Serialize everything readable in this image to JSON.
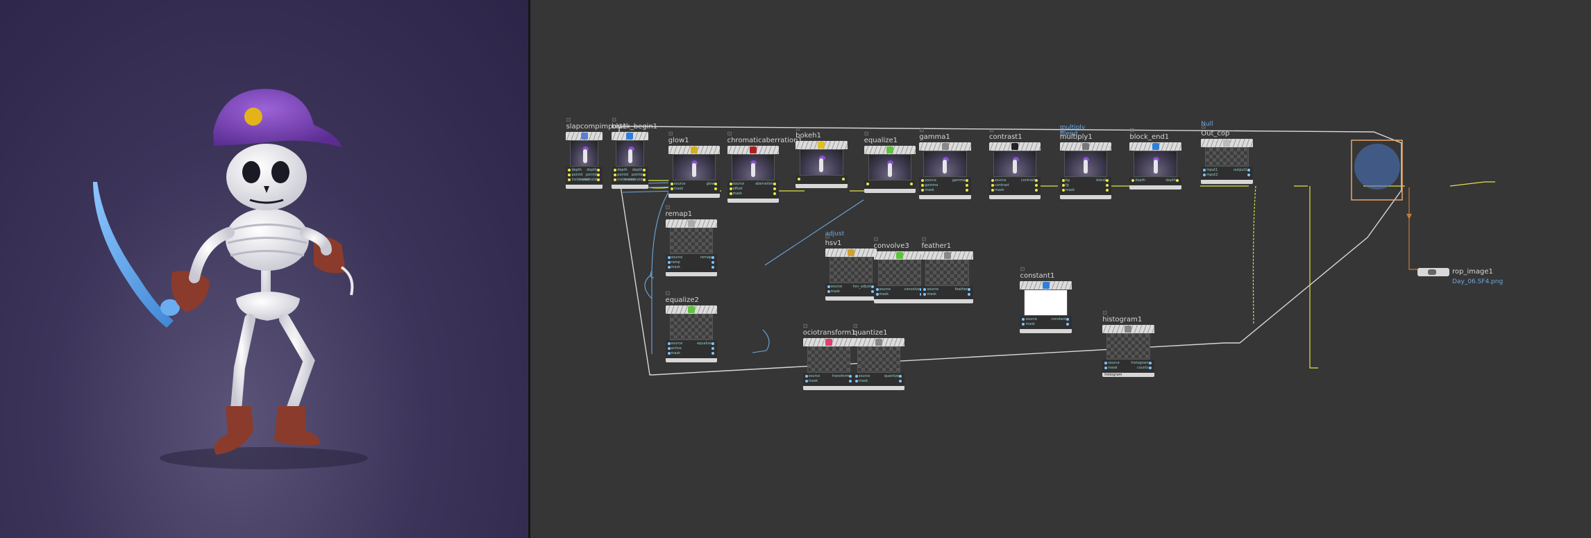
{
  "network": {
    "block_begin_label": "block_begin1",
    "nodes": [
      {
        "id": "slapcompimport1",
        "title": "slapcompimport1",
        "thumb": "skel",
        "ports": [
          [
            "depth",
            "depth"
          ],
          [
            "pointd",
            "pointd"
          ],
          [
            "instanceid",
            "instanceid"
          ]
        ],
        "icon": "#5a7fd0"
      },
      {
        "id": "block_begin1",
        "title": "block_begin1",
        "thumb": "skel",
        "ports": [
          [
            "depth",
            "depth"
          ],
          [
            "pointd",
            "pointd"
          ],
          [
            "instanceid",
            "instanceid"
          ]
        ],
        "icon": "#2f7fd8"
      },
      {
        "id": "glow1",
        "title": "glow1",
        "thumb": "skel",
        "ports": [
          [
            "source",
            "glow"
          ],
          [
            "mask",
            ""
          ]
        ],
        "icon": "#d0b020"
      },
      {
        "id": "chromaticaberration1",
        "title": "chromaticaberration1",
        "thumb": "skel",
        "ports": [
          [
            "source",
            "aberration"
          ],
          [
            "offset",
            ""
          ],
          [
            "mask",
            ""
          ]
        ],
        "icon": "#b02020"
      },
      {
        "id": "bokeh1",
        "title": "bokeh1",
        "thumb": "skel",
        "ports": [
          [
            "",
            ""
          ]
        ],
        "icon": "#e0c020"
      },
      {
        "id": "equalize1",
        "title": "equalize1",
        "thumb": "skel",
        "ports": [
          [
            "",
            ""
          ]
        ],
        "icon": "#60c040"
      },
      {
        "id": "gamma1",
        "title": "gamma1",
        "thumb": "skel",
        "ports": [
          [
            "source",
            "gamma"
          ],
          [
            "gamma",
            ""
          ],
          [
            "mask",
            ""
          ]
        ],
        "icon": "#888"
      },
      {
        "id": "contrast1",
        "title": "contrast1",
        "thumb": "skel",
        "ports": [
          [
            "source",
            "contrast"
          ],
          [
            "contrast",
            ""
          ],
          [
            "mask",
            ""
          ]
        ],
        "icon": "#222"
      },
      {
        "id": "multiply1",
        "title": "multiply1",
        "sup": "multiply\nBlend",
        "thumb": "skel",
        "ports": [
          [
            "bg",
            "blend"
          ],
          [
            "fg",
            ""
          ],
          [
            "mask",
            ""
          ]
        ],
        "icon": "#777"
      },
      {
        "id": "block_end1",
        "title": "block_end1",
        "thumb": "skel",
        "ports": [
          [
            "depth",
            "depth"
          ]
        ],
        "icon": "#2f7fd8"
      },
      {
        "id": "Out_cop",
        "title": "Out_cop",
        "sup": "Null",
        "thumb": "checker",
        "ports": [
          [
            "input1",
            "output1"
          ],
          [
            "input2",
            ""
          ]
        ],
        "icon": "#bbb"
      },
      {
        "id": "remap1",
        "title": "remap1",
        "thumb": "checker",
        "ports": [
          [
            "source",
            "remap"
          ],
          [
            "ramp",
            ""
          ],
          [
            "mask",
            ""
          ]
        ],
        "icon": "#aaa"
      },
      {
        "id": "equalize2",
        "title": "equalize2",
        "thumb": "checker",
        "ports": [
          [
            "source",
            "equalize"
          ],
          [
            "active",
            ""
          ],
          [
            "mask",
            ""
          ]
        ],
        "icon": "#60c040"
      },
      {
        "id": "hsv1",
        "title": "hsv1",
        "sup": "adjust",
        "thumb": "checker",
        "ports": [
          [
            "source",
            "hsv_adjust"
          ],
          [
            "mask",
            ""
          ]
        ],
        "icon": "#d0a030"
      },
      {
        "id": "convolve3",
        "title": "convolve3",
        "thumb": "checker",
        "ports": [
          [
            "source",
            "convolve"
          ],
          [
            "mask",
            ""
          ]
        ],
        "icon": "#60c040"
      },
      {
        "id": "feather1",
        "title": "feather1",
        "thumb": "checker",
        "ports": [
          [
            "source",
            "feather"
          ],
          [
            "mask",
            ""
          ]
        ],
        "icon": "#888"
      },
      {
        "id": "ociotransform1",
        "title": "ociotransform1",
        "thumb": "checker",
        "ports": [
          [
            "source",
            "transform"
          ],
          [
            "mask",
            ""
          ]
        ],
        "icon": "#e04070"
      },
      {
        "id": "quantize1",
        "title": "quantize1",
        "thumb": "checker",
        "ports": [
          [
            "source",
            "quantize"
          ],
          [
            "mask",
            ""
          ]
        ],
        "icon": "#888"
      },
      {
        "id": "constant1",
        "title": "constant1",
        "thumb": "white",
        "ports": [
          [
            "source",
            "constant"
          ],
          [
            "mask",
            ""
          ]
        ],
        "icon": "#2f7fd8"
      },
      {
        "id": "histogram1",
        "title": "histogram1",
        "thumb": "checker",
        "ports": [
          [
            "source",
            "histogram"
          ],
          [
            "mask",
            "counts"
          ]
        ],
        "foot": "histogram",
        "icon": "#888"
      }
    ],
    "rop": {
      "title": "rop_image1",
      "file": "Day_06.SF4.png"
    }
  }
}
